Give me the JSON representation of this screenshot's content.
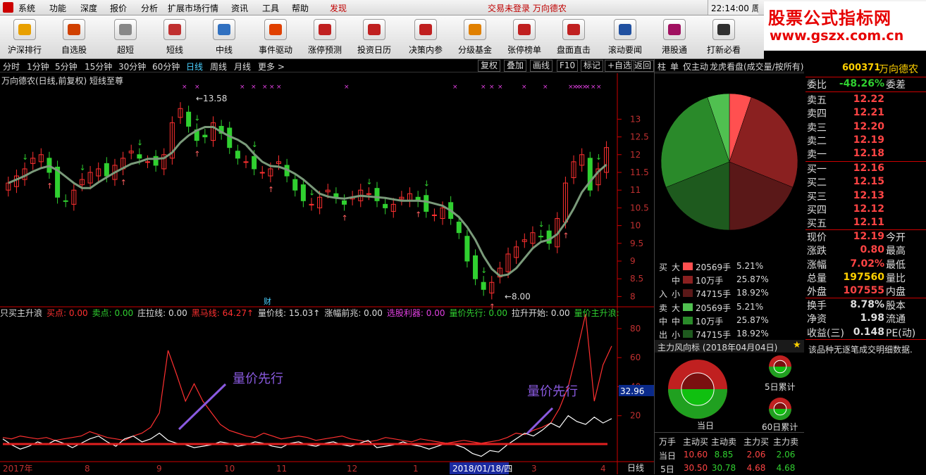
{
  "menu": {
    "items": [
      "系统",
      "功能",
      "深度",
      "报价",
      "分析",
      "扩展市场行情",
      "资讯",
      "工具",
      "帮助",
      "发现"
    ],
    "status": "交易未登录    万向德农",
    "clock": "22:14:00 周六"
  },
  "logo": {
    "title": "股票公式指标网",
    "url": "www.gszx.com.cn"
  },
  "toolbar": [
    {
      "label": "沪深排行",
      "icon": "ranking-icon",
      "color": "#e8a000"
    },
    {
      "label": "自选股",
      "icon": "star-icon",
      "color": "#d04000"
    },
    {
      "label": "超短",
      "icon": "candles-icon",
      "color": "#888888"
    },
    {
      "label": "短线",
      "icon": "candles-icon",
      "color": "#c03030"
    },
    {
      "label": "中线",
      "icon": "candles-icon",
      "color": "#3070c0"
    },
    {
      "label": "事件驱动",
      "icon": "fire-icon",
      "color": "#e04000"
    },
    {
      "label": "涨停预测",
      "icon": "arrow-up-icon",
      "color": "#c02020"
    },
    {
      "label": "投资日历",
      "icon": "calendar-icon",
      "color": "#c02020"
    },
    {
      "label": "决策内参",
      "icon": "book-icon",
      "color": "#c02020"
    },
    {
      "label": "分级基金",
      "icon": "pyramid-icon",
      "color": "#e08000"
    },
    {
      "label": "张停榜单",
      "icon": "trophy-icon",
      "color": "#c02020"
    },
    {
      "label": "盘面直击",
      "icon": "target-icon",
      "color": "#c02020"
    },
    {
      "label": "滚动要闻",
      "icon": "news-icon",
      "color": "#2050a0"
    },
    {
      "label": "港股通",
      "icon": "hk-icon",
      "color": "#a01060"
    },
    {
      "label": "打新必看",
      "icon": "ipo-icon",
      "color": "#303030"
    }
  ],
  "periods": [
    "分时",
    "1分钟",
    "5分钟",
    "15分钟",
    "30分钟",
    "60分钟",
    "日线",
    "周线",
    "月线",
    "更多 >"
  ],
  "active_period": "日线",
  "chart_tools": [
    "复权",
    "叠加",
    "画线",
    "F10",
    "标记",
    "+自选",
    "返回"
  ],
  "chart_title": "万向德农(日线,前复权) 短线至尊",
  "indicator_line": [
    {
      "text": "只买主升浪",
      "color": "#dddddd"
    },
    {
      "text": "买点: 0.00",
      "color": "#ff3030"
    },
    {
      "text": "卖点: 0.00",
      "color": "#30d030"
    },
    {
      "text": "庄拉线: 0.00",
      "color": "#dddddd"
    },
    {
      "text": "黑马线: 64.27↑",
      "color": "#ff3030"
    },
    {
      "text": "量价线: 15.03↑",
      "color": "#dddddd"
    },
    {
      "text": "涨幅前兆: 0.00",
      "color": "#dddddd"
    },
    {
      "text": "选股利器: 0.00",
      "color": "#e040e0"
    },
    {
      "text": "量价先行: 0.00",
      "color": "#30d030"
    },
    {
      "text": "拉升开始: 0.00",
      "color": "#dddddd"
    },
    {
      "text": "量价主升浪: 0.00",
      "color": "#30d030"
    },
    {
      "text": "庄拉",
      "color": "#ff3030"
    }
  ],
  "annotations": {
    "lvjia1": "量价先行",
    "lvjia2": "量价先行",
    "high": "13.58",
    "low": "8.00",
    "cai": "财",
    "cursor_value": "32.96"
  },
  "axis_period_label": "日线",
  "chart_data": [
    {
      "type": "candlestick",
      "title": "万向德农(日线,前复权) 短线至尊",
      "y_ticks": [
        13.0,
        12.5,
        12.0,
        11.5,
        11.0,
        10.5,
        10.0,
        9.5,
        9.0,
        8.5,
        8.0
      ],
      "ylim": [
        7.75,
        13.9
      ],
      "x_labels": [
        "2017年",
        "8",
        "9",
        "10",
        "11",
        "12",
        "1",
        "2018/01/18/四",
        "3",
        "4"
      ],
      "annotated_high": 13.58,
      "annotated_low": 8.0,
      "close_series": [
        11.2,
        11.4,
        11.6,
        11.9,
        12.0,
        11.5,
        10.8,
        10.7,
        11.0,
        11.3,
        11.5,
        11.6,
        11.4,
        11.7,
        11.9,
        12.1,
        11.9,
        11.8,
        11.7,
        12.0,
        12.9,
        13.3,
        12.8,
        12.4,
        12.5,
        12.9,
        12.6,
        12.2,
        11.9,
        11.8,
        11.6,
        11.5,
        11.6,
        11.8,
        11.4,
        11.0,
        10.7,
        10.6,
        10.8,
        11.0,
        10.8,
        10.6,
        10.8,
        11.0,
        10.9,
        10.7,
        10.5,
        10.6,
        10.8,
        10.9,
        10.7,
        10.4,
        10.3,
        10.5,
        10.2,
        9.8,
        9.0,
        8.5,
        8.2,
        8.4,
        8.8,
        9.2,
        9.4,
        9.6,
        9.8,
        9.7,
        9.5,
        10.2,
        11.2,
        11.8,
        12.0,
        11.0,
        11.6,
        12.2
      ]
    },
    {
      "type": "line",
      "y_ticks": [
        80.0,
        60.0,
        40.0,
        20.0
      ],
      "ylim": [
        0,
        95
      ],
      "series": [
        {
          "name": "黑马线",
          "color": "#ff3030",
          "values": [
            5,
            4,
            6,
            5,
            4,
            5,
            3,
            4,
            5,
            6,
            9,
            7,
            5,
            4,
            3,
            6,
            8,
            12,
            22,
            65,
            48,
            30,
            42,
            30,
            22,
            14,
            10,
            8,
            6,
            5,
            8,
            6,
            4,
            5,
            6,
            5,
            3,
            4,
            5,
            6,
            4,
            3,
            2,
            3,
            5,
            4,
            3,
            2,
            4,
            3,
            2,
            1,
            2,
            3,
            2,
            1,
            2,
            3,
            5,
            8,
            7,
            10,
            12,
            15,
            25,
            40,
            64,
            90,
            30,
            55,
            68
          ]
        },
        {
          "name": "量价线",
          "color": "#ffffff",
          "values": [
            4,
            0,
            -3,
            -1,
            2,
            0,
            3,
            1,
            -2,
            1,
            4,
            6,
            2,
            -1,
            4,
            6,
            2,
            4,
            8,
            3,
            1,
            0,
            -2,
            -1,
            0,
            2,
            1,
            -1,
            0,
            2,
            1,
            -1,
            -2,
            1,
            2,
            0,
            -1,
            1,
            2,
            0,
            -1,
            1,
            3,
            -2,
            -1,
            0,
            2,
            0,
            -1,
            -3,
            -1,
            1,
            0,
            -2,
            -6,
            -8,
            -4,
            -5,
            0,
            4,
            8,
            6,
            10,
            15,
            12,
            20,
            16,
            14,
            19,
            15,
            18
          ]
        }
      ]
    }
  ],
  "right_panel": {
    "tabs": [
      "柱",
      "单",
      "仅主动",
      "龙虎看盘(成交量/按所有)"
    ],
    "stock": {
      "code": "600371",
      "name": "万向德农"
    },
    "weibi": {
      "label": "委比",
      "value": "-48.26%",
      "label2": "委差"
    },
    "asks": [
      {
        "label": "卖五",
        "price": "12.22"
      },
      {
        "label": "卖四",
        "price": "12.21"
      },
      {
        "label": "卖三",
        "price": "12.20"
      },
      {
        "label": "卖二",
        "price": "12.19"
      },
      {
        "label": "卖一",
        "price": "12.18"
      }
    ],
    "bids": [
      {
        "label": "买一",
        "price": "12.16"
      },
      {
        "label": "买二",
        "price": "12.15"
      },
      {
        "label": "买三",
        "price": "12.13"
      },
      {
        "label": "买四",
        "price": "12.12"
      },
      {
        "label": "买五",
        "price": "12.11"
      }
    ],
    "stats": [
      {
        "l1": "现价",
        "v": "12.19",
        "l2": "今开",
        "c": "#ff4444"
      },
      {
        "l1": "涨跌",
        "v": "0.80",
        "l2": "最高",
        "c": "#ff4444"
      },
      {
        "l1": "涨幅",
        "v": "7.02%",
        "l2": "最低",
        "c": "#ff4444"
      },
      {
        "l1": "总量",
        "v": "197560",
        "l2": "量比",
        "c": "#ffd000"
      },
      {
        "l1": "外盘",
        "v": "107555",
        "l2": "内盘",
        "c": "#ff4444"
      }
    ],
    "stats2": [
      {
        "l1": "换手",
        "v": "8.78%",
        "l2": "股本",
        "c": "#dddddd"
      },
      {
        "l1": "净资",
        "v": "1.98",
        "l2": "流通",
        "c": "#dddddd"
      },
      {
        "l1": "收益(三)",
        "v": "0.148",
        "l2": "PE(动)",
        "c": "#dddddd"
      }
    ],
    "no_detail": "该品种无逐笔成交明细数据.",
    "pie": {
      "type": "pie",
      "slices": [
        {
          "name": "买大",
          "pct": 5.21,
          "color": "#ff5050"
        },
        {
          "name": "买中",
          "pct": 25.87,
          "color": "#8a2020"
        },
        {
          "name": "买小",
          "pct": 18.92,
          "color": "#5a1818"
        },
        {
          "name": "卖小",
          "pct": 18.92,
          "color": "#1e5a1e"
        },
        {
          "name": "卖中",
          "pct": 25.87,
          "color": "#2a8a2a"
        },
        {
          "name": "卖大",
          "pct": 5.21,
          "color": "#50c050"
        }
      ]
    },
    "flow_buy": [
      {
        "side": "买",
        "size": "大",
        "amount": "20569手",
        "pct": "5.21%",
        "color": "#ff5050"
      },
      {
        "side": "",
        "size": "中",
        "amount": "10万手",
        "pct": "25.87%",
        "color": "#8a2020"
      },
      {
        "side": "入",
        "size": "小",
        "amount": "74715手",
        "pct": "18.92%",
        "color": "#5a1818"
      }
    ],
    "flow_sell": [
      {
        "side": "卖",
        "size": "大",
        "amount": "20569手",
        "pct": "5.21%",
        "color": "#50c050"
      },
      {
        "side": "中",
        "size": "中",
        "amount": "10万手",
        "pct": "25.87%",
        "color": "#2a8a2a"
      },
      {
        "side": "出",
        "size": "小",
        "amount": "74715手",
        "pct": "18.92%",
        "color": "#1e5a1e"
      }
    ],
    "rose_title": "主力风向标 (2018年04月04日)",
    "rose_labels": {
      "today": "当日",
      "d5": "5日累计",
      "d60": "60日累计"
    },
    "mf_header": [
      "万手",
      "主动买",
      "主动卖",
      "主力买",
      "主力卖"
    ],
    "mf_rows": [
      {
        "label": "当日",
        "vals": [
          "10.60",
          "8.85",
          "2.06",
          "2.06"
        ]
      },
      {
        "label": "5日",
        "vals": [
          "30.50",
          "30.78",
          "4.68",
          "4.68"
        ]
      }
    ]
  }
}
